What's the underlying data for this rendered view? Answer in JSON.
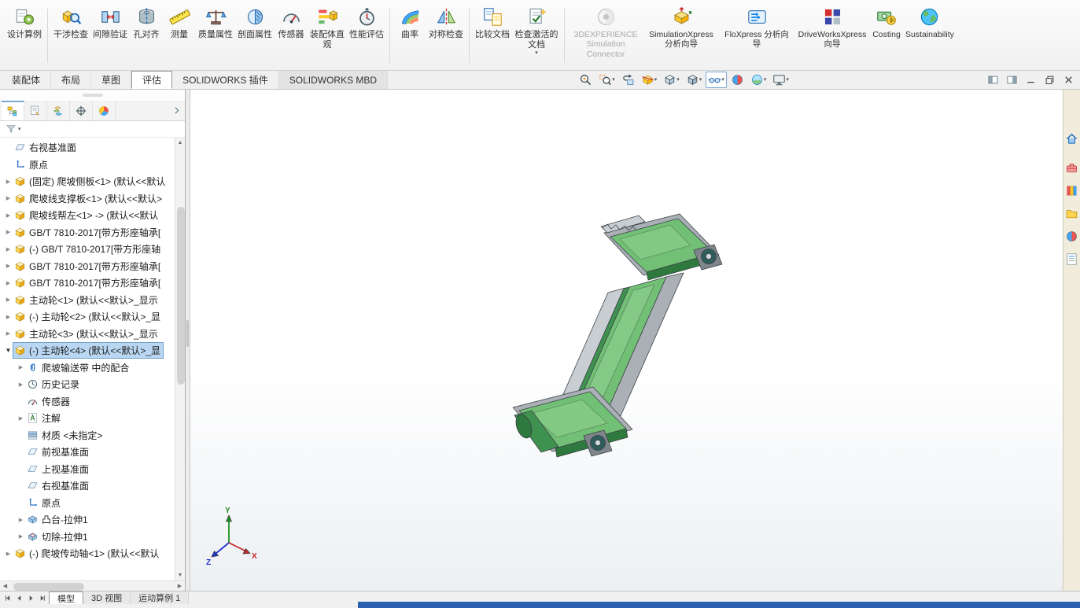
{
  "colors": {
    "belt_green": "#72c075",
    "belt_green_light": "#9ad89c",
    "belt_green_dark": "#3f9150",
    "belt_edge_dark": "#2e7a3e",
    "frame_gray": "#aab0b5",
    "frame_gray_light": "#c9ced2",
    "frame_gray_dark": "#7e858b",
    "bearing_dark": "#2f5d5c",
    "selection_blue": "#b9d7f2",
    "taskbar_blue": "#2b5fb0",
    "viewport_bg_top": "#ffffff",
    "viewport_bg_bottom": "#edf0f3",
    "axis_x": "#c62828",
    "axis_y": "#1e8f1e",
    "axis_z": "#2233cc"
  },
  "ribbon": {
    "buttons": [
      {
        "id": "design-study",
        "label": "设计算例",
        "icon": "design-study-icon",
        "sep_after": true
      },
      {
        "id": "interference-detection",
        "label": "干涉检查",
        "icon": "interference-detection-icon"
      },
      {
        "id": "clearance-verification",
        "label": "间隙验证",
        "icon": "clearance-verification-icon"
      },
      {
        "id": "hole-alignment",
        "label": "孔对齐",
        "icon": "hole-alignment-icon"
      },
      {
        "id": "measure",
        "label": "测量",
        "icon": "measure-icon"
      },
      {
        "id": "mass-properties",
        "label": "质量属性",
        "icon": "mass-properties-icon"
      },
      {
        "id": "section-properties",
        "label": "剖面属性",
        "icon": "section-properties-icon"
      },
      {
        "id": "sensor",
        "label": "传感器",
        "icon": "sensor-icon"
      },
      {
        "id": "assembly-visualization",
        "label": "装配体直观",
        "icon": "assembly-visualization-icon"
      },
      {
        "id": "performance-evaluation",
        "label": "性能评估",
        "icon": "performance-evaluation-icon",
        "sep_after": true
      },
      {
        "id": "curvature",
        "label": "曲率",
        "icon": "curvature-icon"
      },
      {
        "id": "symmetry-check",
        "label": "对称检查",
        "icon": "symmetry-check-icon",
        "sep_after": true
      },
      {
        "id": "compare-documents",
        "label": "比较文档",
        "icon": "compare-documents-icon"
      },
      {
        "id": "check-active-document",
        "label": "检查激活的文档",
        "icon": "check-active-document-icon",
        "caret": true,
        "sep_after": true
      },
      {
        "id": "3dexperience-simulation-connector",
        "label": "3DEXPERIENCE Simulation Connector",
        "icon": "3dexperience-connector-icon",
        "wide": true,
        "disabled": true
      },
      {
        "id": "simulationxpress",
        "label": "SimulationXpress 分析向导",
        "icon": "simulationxpress-icon",
        "wide": true
      },
      {
        "id": "floxpress",
        "label": "FloXpress 分析向导",
        "icon": "floxpress-icon",
        "wide": true
      },
      {
        "id": "driveworksxpress",
        "label": "DriveWorksXpress 向导",
        "icon": "driveworksxpress-icon",
        "wide": true
      },
      {
        "id": "costing",
        "label": "Costing",
        "icon": "costing-icon",
        "wide": true
      },
      {
        "id": "sustainability",
        "label": "Sustainability",
        "icon": "sustainability-icon",
        "wide": true
      }
    ]
  },
  "document_tabs": {
    "items": [
      {
        "id": "assembly",
        "label": "装配体"
      },
      {
        "id": "layout",
        "label": "布局"
      },
      {
        "id": "sketch",
        "label": "草图"
      },
      {
        "id": "evaluate",
        "label": "评估",
        "active": true
      },
      {
        "id": "solidworks-addins",
        "label": "SOLIDWORKS 插件"
      },
      {
        "id": "solidworks-mbd",
        "label": "SOLIDWORKS MBD",
        "muted": true
      }
    ]
  },
  "headsup": {
    "icons": [
      {
        "name": "zoom-fit-icon"
      },
      {
        "name": "zoom-area-icon",
        "caret": true
      },
      {
        "name": "previous-view-icon"
      },
      {
        "name": "section-view-icon",
        "caret": true
      },
      {
        "name": "view-orientation-icon",
        "caret": true
      },
      {
        "name": "display-style-icon",
        "caret": true
      },
      {
        "name": "hide-show-items-icon",
        "caret": true,
        "active": true
      },
      {
        "name": "edit-appearance-icon"
      },
      {
        "name": "apply-scene-icon",
        "caret": true
      },
      {
        "name": "view-settings-icon",
        "caret": true
      }
    ]
  },
  "window_controls": {
    "buttons": [
      {
        "name": "dock-left"
      },
      {
        "name": "dock-right"
      },
      {
        "name": "minimize"
      },
      {
        "name": "restore"
      },
      {
        "name": "close"
      }
    ]
  },
  "feature_panel": {
    "tabs": [
      {
        "name": "featuremanager-tab-icon",
        "active": true
      },
      {
        "name": "propertymanager-tab-icon"
      },
      {
        "name": "configurationmanager-tab-icon"
      },
      {
        "name": "dimxpertmanager-tab-icon"
      },
      {
        "name": "displaymanager-tab-icon"
      }
    ],
    "filter": {
      "icon": "filter-icon"
    },
    "tree": [
      {
        "label": "右视基准面",
        "icon": "plane-icon"
      },
      {
        "label": "原点",
        "icon": "origin-icon"
      },
      {
        "label": "(固定) 爬坡侧板<1> (默认<<默认",
        "icon": "component-icon",
        "arrow": "collapsed"
      },
      {
        "label": "爬坡线支撑板<1> (默认<<默认>",
        "icon": "component-icon",
        "arrow": "collapsed"
      },
      {
        "label": "爬坡线帮左<1> -> (默认<<默认",
        "icon": "component-icon",
        "arrow": "collapsed"
      },
      {
        "label": "GB/T 7810-2017[带方形座轴承[",
        "icon": "component-icon",
        "arrow": "collapsed"
      },
      {
        "label": "(-) GB/T 7810-2017[带方形座轴",
        "icon": "component-icon",
        "arrow": "collapsed"
      },
      {
        "label": "GB/T 7810-2017[带方形座轴承[",
        "icon": "component-icon",
        "arrow": "collapsed"
      },
      {
        "label": "GB/T 7810-2017[带方形座轴承[",
        "icon": "component-icon",
        "arrow": "collapsed"
      },
      {
        "label": "主动轮<1> (默认<<默认>_显示",
        "icon": "component-icon",
        "arrow": "collapsed"
      },
      {
        "label": "(-) 主动轮<2> (默认<<默认>_显",
        "icon": "component-icon",
        "arrow": "collapsed"
      },
      {
        "label": "主动轮<3> (默认<<默认>_显示",
        "icon": "component-icon",
        "arrow": "collapsed"
      },
      {
        "label": "(-) 主动轮<4> (默认<<默认>_显",
        "icon": "component-icon",
        "arrow": "expanded",
        "selected": true,
        "children": [
          {
            "label": "爬坡输送带 中的配合",
            "icon": "mates-icon",
            "arrow": "collapsed"
          },
          {
            "label": "历史记录",
            "icon": "history-icon",
            "arrow": "collapsed"
          },
          {
            "label": "传感器",
            "icon": "sensors-icon"
          },
          {
            "label": "注解",
            "icon": "annotations-icon",
            "arrow": "collapsed"
          },
          {
            "label": "材质 <未指定>",
            "icon": "material-icon"
          },
          {
            "label": "前视基准面",
            "icon": "plane-icon"
          },
          {
            "label": "上视基准面",
            "icon": "plane-icon"
          },
          {
            "label": "右视基准面",
            "icon": "plane-icon"
          },
          {
            "label": "原点",
            "icon": "origin-icon"
          },
          {
            "label": "凸台-拉伸1",
            "icon": "boss-extrude-icon",
            "arrow": "collapsed"
          },
          {
            "label": "切除-拉伸1",
            "icon": "cut-extrude-icon",
            "arrow": "collapsed"
          }
        ]
      },
      {
        "label": "(-) 爬坡传动轴<1> (默认<<默认",
        "icon": "component-icon",
        "arrow": "collapsed"
      }
    ]
  },
  "task_pane": {
    "icons": [
      {
        "name": "home-icon"
      },
      {
        "name": "solidworks-resources-icon"
      },
      {
        "name": "design-library-icon"
      },
      {
        "name": "file-explorer-icon"
      },
      {
        "name": "appearances-icon"
      },
      {
        "name": "custom-properties-icon"
      }
    ]
  },
  "viewport": {
    "triad": {
      "x": "X",
      "y": "Y",
      "z": "Z"
    }
  },
  "status_bar": {
    "nav": [
      {
        "name": "go-start"
      },
      {
        "name": "go-prev"
      },
      {
        "name": "go-next"
      },
      {
        "name": "go-end"
      }
    ],
    "tabs": [
      {
        "id": "model",
        "label": "模型",
        "active": true
      },
      {
        "id": "3d-views",
        "label": "3D 视图"
      },
      {
        "id": "motion-study-1",
        "label": "运动算例 1"
      }
    ]
  }
}
